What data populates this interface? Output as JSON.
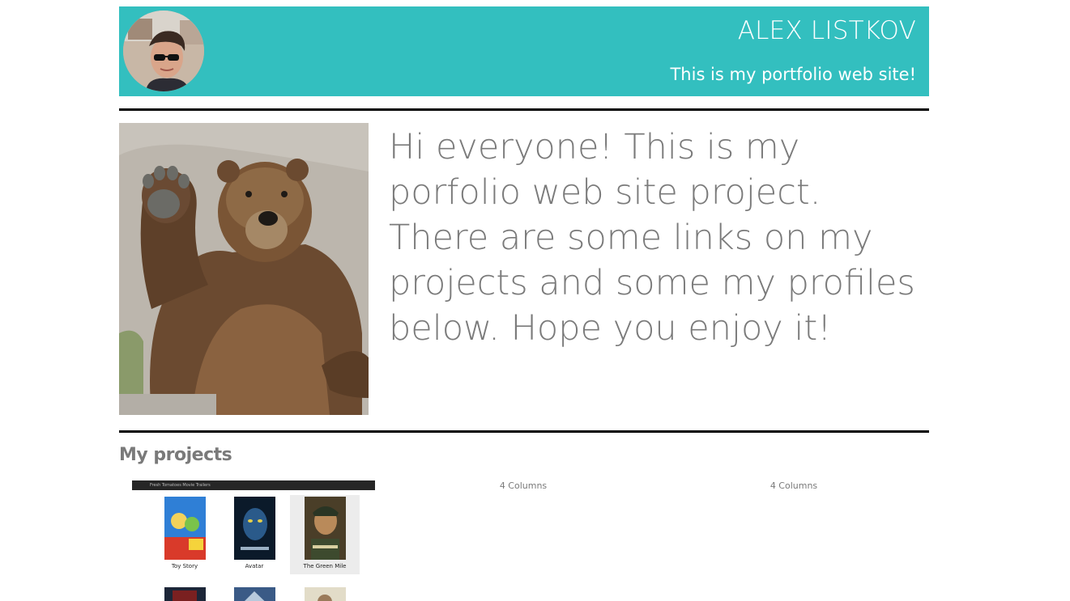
{
  "header": {
    "name": "ALEX LISTKOV",
    "tagline": "This is my portfolio web site!"
  },
  "intro": {
    "text": "Hi everyone! This is my porfolio web site project. There are some links on my projects and some my profiles below. Hope you enjoy it!"
  },
  "projects": {
    "heading": "My projects",
    "first_project": {
      "bar_title": "Fresh Tomatoes Movie Trailers",
      "movies": [
        "Toy Story",
        "Avatar",
        "The Green Mile"
      ]
    },
    "column_labels": [
      "4 Columns",
      "4 Columns"
    ]
  },
  "colors": {
    "header_bg": "#33bfbf",
    "text_gray": "#7a7a7a",
    "rule": "#000000"
  }
}
